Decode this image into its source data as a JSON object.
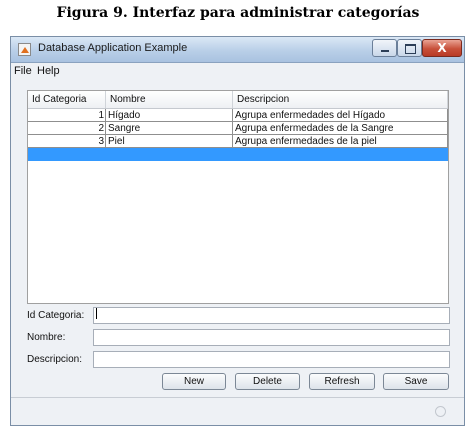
{
  "caption": "Figura 9. Interfaz para administrar categorías",
  "window": {
    "title": "Database Application Example",
    "controls": {
      "minimize": "minimize",
      "maximize": "maximize",
      "close": "X"
    }
  },
  "menu": {
    "items": [
      "File",
      "Help"
    ]
  },
  "table": {
    "columns": [
      "Id Categoria",
      "Nombre",
      "Descripcion"
    ],
    "rows": [
      {
        "id": "1",
        "nombre": "Hígado",
        "descripcion": "Agrupa enfermedades del Hígado"
      },
      {
        "id": "2",
        "nombre": "Sangre",
        "descripcion": "Agrupa enfermedades de la Sangre"
      },
      {
        "id": "3",
        "nombre": "Piel",
        "descripcion": "Agrupa enfermedades de la piel"
      },
      {
        "id": "",
        "nombre": "",
        "descripcion": ""
      }
    ],
    "selected_row_index": 3,
    "selection_color": "#3399ff"
  },
  "form": {
    "id_label": "Id Categoria:",
    "id_value": "",
    "nombre_label": "Nombre:",
    "nombre_value": "",
    "descripcion_label": "Descripcion:",
    "descripcion_value": ""
  },
  "buttons": {
    "new": "New",
    "delete": "Delete",
    "refresh": "Refresh",
    "save": "Save"
  }
}
